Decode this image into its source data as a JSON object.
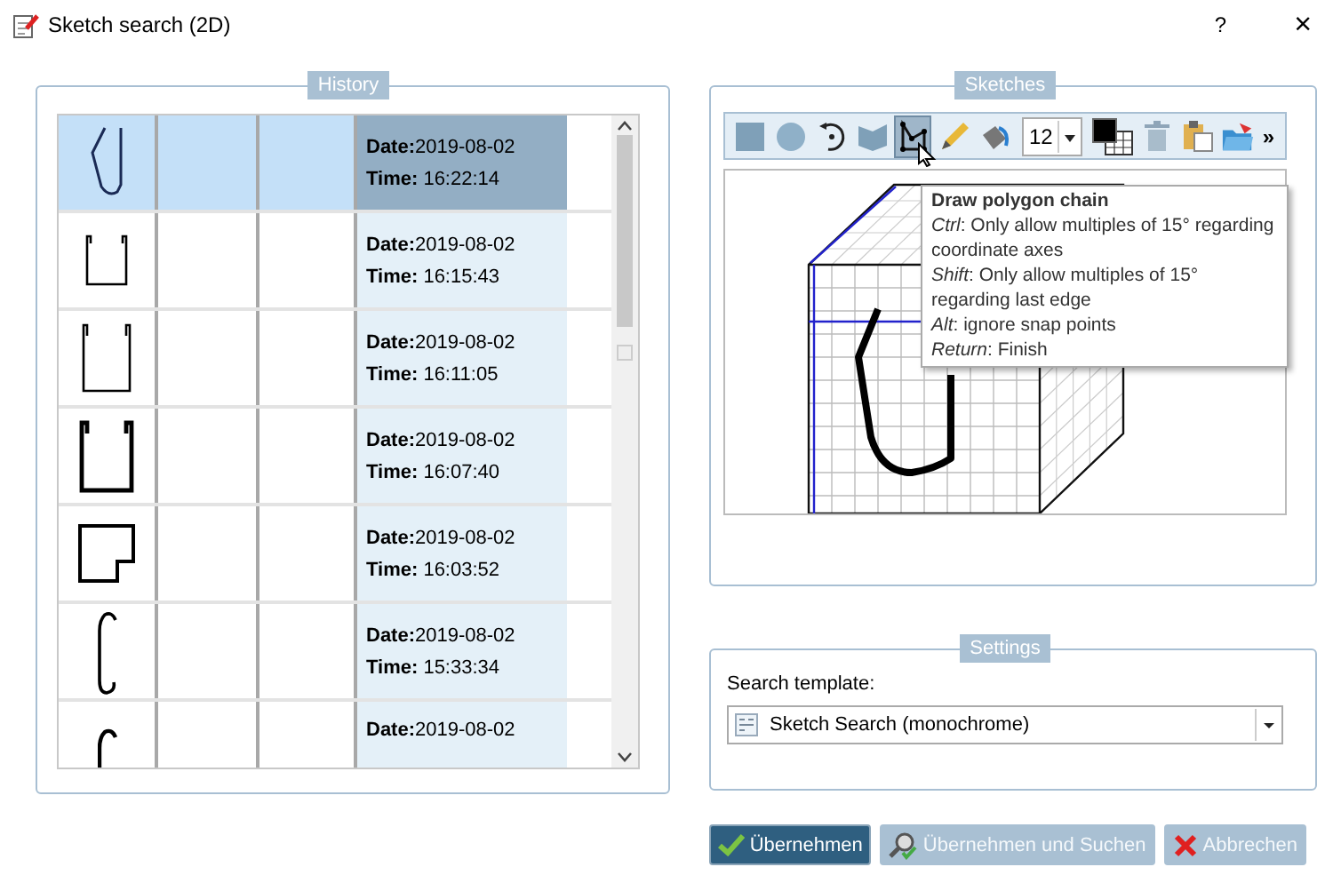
{
  "window": {
    "title": "Sketch search (2D)",
    "help": "?",
    "close": "×"
  },
  "history": {
    "title": "History",
    "rows": [
      {
        "kind": "u-curve",
        "date": "**Date:**2019-08-02",
        "time": "**Time:** 16:22:14",
        "selected": true
      },
      {
        "kind": "channel-small",
        "date": "**Date:**2019-08-02",
        "time": "**Time:** 16:15:43",
        "selected": false
      },
      {
        "kind": "channel",
        "date": "**Date:**2019-08-02",
        "time": "**Time:** 16:11:05",
        "selected": false
      },
      {
        "kind": "channel-bold",
        "date": "**Date:**2019-08-02",
        "time": "**Time:** 16:07:40",
        "selected": false
      },
      {
        "kind": "notch-square",
        "date": "**Date:**2019-08-02",
        "time": "**Time:** 16:03:52",
        "selected": false
      },
      {
        "kind": "hook",
        "date": "**Date:**2019-08-02",
        "time": "**Time:** 15:33:34",
        "selected": false
      },
      {
        "kind": "hook-tall",
        "date": "**Date:**2019-08-02",
        "selected": false
      }
    ]
  },
  "sketches": {
    "title": "Sketches",
    "toolbar": {
      "tools": [
        {
          "kind": "square",
          "selected": false
        },
        {
          "kind": "circle",
          "selected": false
        },
        {
          "kind": "rotate",
          "selected": false
        },
        {
          "kind": "flag",
          "selected": false
        },
        {
          "kind": "polygon",
          "selected": true
        },
        {
          "kind": "pencil",
          "selected": false
        },
        {
          "kind": "fill",
          "selected": false
        },
        {
          "kind": "size",
          "value": "12",
          "selected": false
        },
        {
          "kind": "color",
          "selected": false
        },
        {
          "kind": "trash",
          "selected": false
        },
        {
          "kind": "paste",
          "selected": false
        },
        {
          "kind": "open",
          "selected": false
        },
        {
          "kind": "more",
          "label": "»",
          "selected": false
        }
      ]
    },
    "tooltip": {
      "title": "Draw polygon chain",
      "lines": [
        "*Ctrl*: Only allow multiples of 15° regarding coordinate axes",
        "*Shift*: Only allow multiples of 15° regarding last edge",
        "*Alt*: ignore snap points",
        "*Return*: Finish"
      ]
    }
  },
  "settings": {
    "title": "Settings",
    "search_template_label": "Search template:",
    "search_template": "Sketch Search (monochrome)"
  },
  "buttons": [
    {
      "label": "Übernehmen",
      "kind": "apply",
      "disabled": false
    },
    {
      "label": "Übernehmen und Suchen",
      "kind": "apply-search",
      "disabled": true
    },
    {
      "label": "Abbrechen",
      "kind": "cancel",
      "disabled": true
    }
  ]
}
